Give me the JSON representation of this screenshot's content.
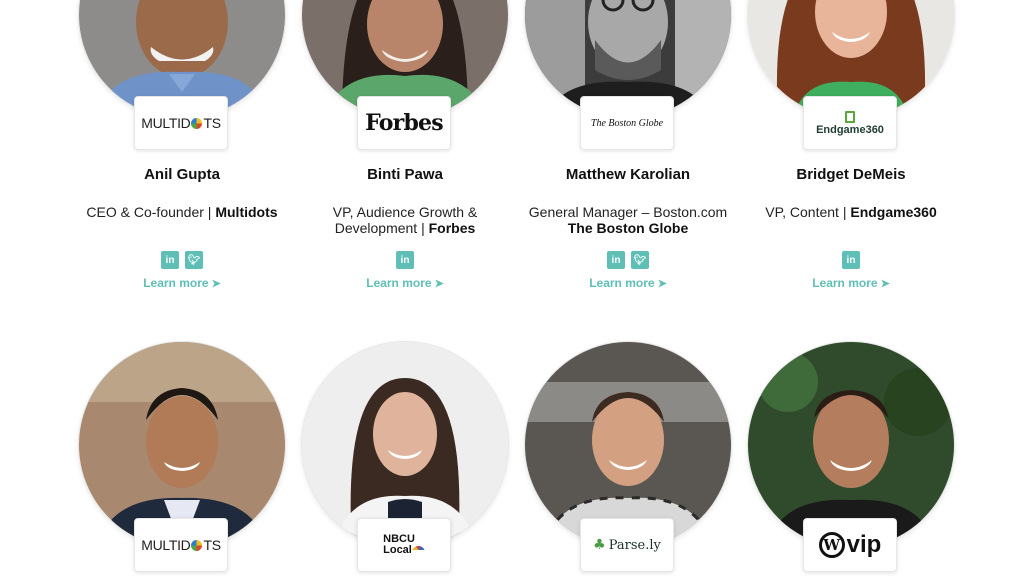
{
  "colors": {
    "accent": "#5fbfb6"
  },
  "learn_more_arrow": "➤",
  "row1": [
    {
      "name": "Anil Gupta",
      "role": "CEO & Co-founder |",
      "company": "Multidots",
      "socials": [
        "in",
        "t"
      ],
      "learn": "Learn more",
      "logo": "MULTID TS"
    },
    {
      "name": "Binti Pawa",
      "role": "VP, Audience Growth & Development |",
      "company": "Forbes",
      "socials": [
        "in"
      ],
      "learn": "Learn more",
      "logo": "Forbes"
    },
    {
      "name": "Matthew Karolian",
      "role": "General Manager – Boston.com",
      "company": "The Boston Globe",
      "socials": [
        "in",
        "t"
      ],
      "learn": "Learn more",
      "logo": "The Boston Globe"
    },
    {
      "name": "Bridget DeMeis",
      "role": "VP, Content |",
      "company": "Endgame360",
      "socials": [
        "in"
      ],
      "learn": "Learn more",
      "logo": "Endgame360"
    }
  ],
  "row2": [
    {
      "logo": "MULTID TS"
    },
    {
      "logo_line1": "NBCU",
      "logo_line2": "Local"
    },
    {
      "logo": "Parse.ly"
    },
    {
      "logo": "vip"
    }
  ]
}
